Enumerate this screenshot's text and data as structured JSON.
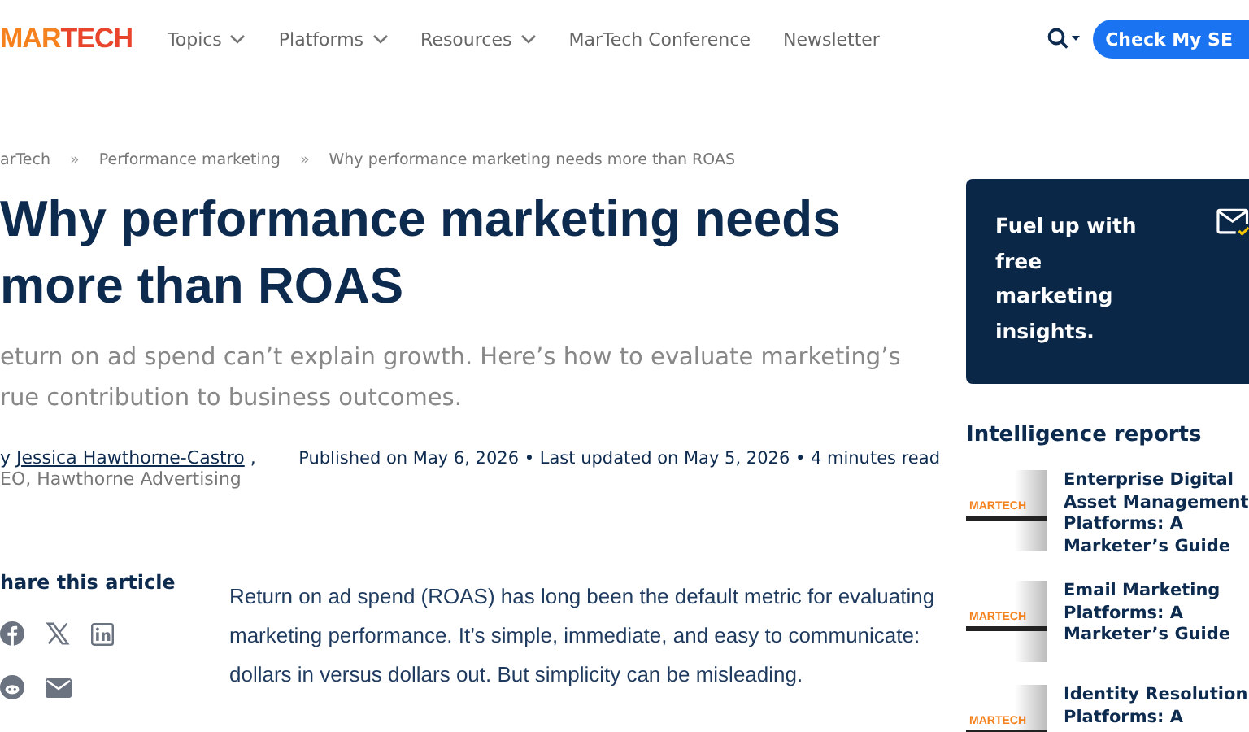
{
  "header": {
    "logo": {
      "part_a": "MAR",
      "part_b": "TECH"
    },
    "nav": [
      {
        "label": "Topics",
        "dropdown": true
      },
      {
        "label": "Platforms",
        "dropdown": true
      },
      {
        "label": "Resources",
        "dropdown": true
      },
      {
        "label": "MarTech Conference",
        "dropdown": false
      },
      {
        "label": "Newsletter",
        "dropdown": false
      }
    ],
    "cta_button": "Check My SE"
  },
  "breadcrumb": [
    "arTech",
    "Performance marketing",
    "Why performance marketing needs more than ROAS"
  ],
  "breadcrumb_separator": "»",
  "title_lines": [
    "Why performance marketing needs",
    "more than ROAS"
  ],
  "subtitle_lines": [
    "eturn on ad spend can’t explain growth. Here’s how to evaluate marketing’s",
    "rue contribution to business outcomes."
  ],
  "author": {
    "prefix": "y",
    "name": "Jessica Hawthorne-Castro",
    "suffix": ",",
    "role": "EO, Hawthorne Advertising"
  },
  "meta": "Published on May 6, 2026 • Last updated on May 5, 2026 • 4 minutes read",
  "share": {
    "heading": "hare this article",
    "icons": [
      {
        "kind": "facebook"
      },
      {
        "kind": "x"
      },
      {
        "kind": "linkedin"
      },
      {
        "kind": "reddit"
      },
      {
        "kind": "email"
      }
    ]
  },
  "body": "Return on ad spend (ROAS) has long been the default metric for evaluating marketing performance. It’s simple, immediate, and easy to communicate: dollars in versus dollars out. But simplicity can be misleading.",
  "promo": {
    "lines": [
      "Fuel up with",
      "free",
      "marketing",
      "insights."
    ]
  },
  "reports": {
    "heading": "Intelligence reports",
    "items": [
      {
        "title": "Enterprise Digital Asset Management Platforms: A Marketer’s Guide",
        "cover_logo": "MARTECH"
      },
      {
        "title": "Email Marketing Platforms: A Marketer’s Guide",
        "cover_logo": "MARTECH"
      },
      {
        "title": "Identity Resolution Platforms: A",
        "cover_logo": "MARTECH"
      }
    ]
  }
}
